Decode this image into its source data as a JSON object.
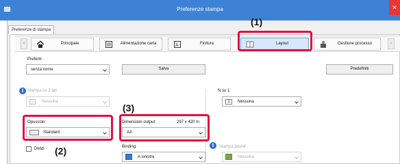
{
  "window": {
    "title": "Preferenze stampa"
  },
  "property_tab": "Preferenze di stampa",
  "nav": {
    "tabs": [
      {
        "label": "Principale",
        "icon": "home-icon"
      },
      {
        "label": "Alimentazione carta",
        "icon": "paper-tray-icon"
      },
      {
        "label": "Finitura",
        "icon": "finishing-icon"
      },
      {
        "label": "Layout",
        "icon": "layout-icon",
        "active": true
      },
      {
        "label": "Gestione processo",
        "icon": "job-handling-icon"
      }
    ]
  },
  "favorites": {
    "label": "Preferiti",
    "value": "senza nome",
    "save_label": "Salva",
    "defaults_label": "Predefiniti"
  },
  "duplex": {
    "label": "Stampa su 2 lati",
    "value": "Nessuna"
  },
  "n_up": {
    "label": "N su 1:",
    "value": "Nessuna",
    "icon_text": "1"
  },
  "booklet": {
    "label": "Opuscolo:",
    "value": "Standard"
  },
  "output_size": {
    "label": "Dimensioni output:",
    "dims": "297 x 420 m",
    "value": "A3"
  },
  "split": {
    "label": "Dividi"
  },
  "binding": {
    "label": "Binding:",
    "value": "A sinistra"
  },
  "poster": {
    "label": "Stampa poster",
    "value": "Nessuna"
  },
  "annotations": {
    "step1": "(1)",
    "step2": "(2)",
    "step3": "(3)"
  },
  "colors": {
    "titlebar": "#3e82d6",
    "highlight": "#e0103f",
    "active_tab": "#d8e8fb"
  }
}
